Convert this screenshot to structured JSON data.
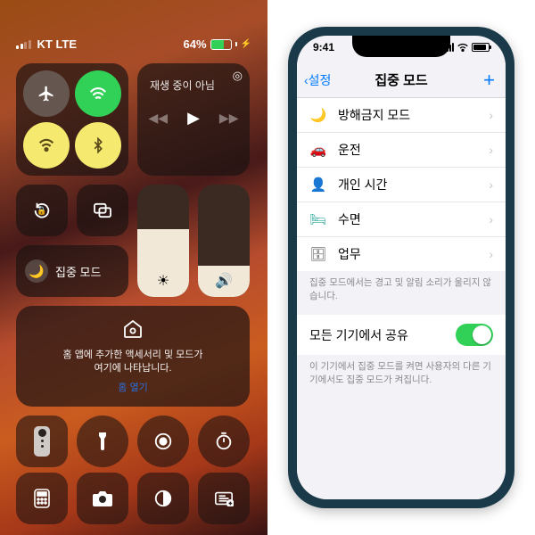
{
  "left": {
    "carrier": "KT LTE",
    "battery_pct": "64%",
    "media_status": "재생 중이 아님",
    "focus_label": "집중 모드",
    "home_msg": "홈 앱에 추가한 액세서리 및 모드가\n여기에 나타납니다.",
    "home_link": "홈 열기"
  },
  "right": {
    "time": "9:41",
    "nav_back": "설정",
    "nav_title": "집중 모드",
    "items": [
      {
        "icon": "🌙",
        "color": "#6d4dd8",
        "label": "방해금지 모드"
      },
      {
        "icon": "🚗",
        "color": "#1e6fd6",
        "label": "운전"
      },
      {
        "icon": "👤",
        "color": "#8e44ad",
        "label": "개인 시간"
      },
      {
        "icon": "🛏",
        "color": "#2aa89a",
        "label": "수면"
      },
      {
        "icon": "💼",
        "color": "#5a5a5f",
        "label": "업무"
      }
    ],
    "footer1": "집중 모드에서는 경고 및 알림 소리가 울리지 않습니다.",
    "share_label": "모든 기기에서 공유",
    "footer2": "이 기기에서 집중 모드를 켜면 사용자의 다른 기기에서도 집중 모드가 켜집니다."
  }
}
